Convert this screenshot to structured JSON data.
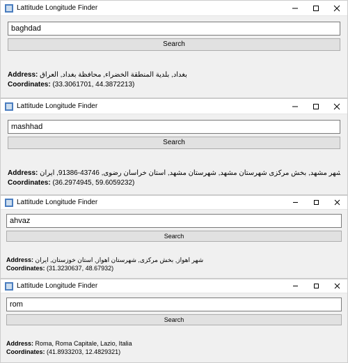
{
  "app_title": "Lattitude Longitude Finder",
  "search_button_label": "Search",
  "labels": {
    "address": "Address:",
    "coordinates": "Coordinates:"
  },
  "windows": [
    {
      "query": "baghdad",
      "address": "بغداد, بلدية المنطقة الخضراء, محافظة بغداد, العراق",
      "coordinates": "(33.3061701, 44.3872213)"
    },
    {
      "query": "mashhad",
      "address": "مشهد, شهر مشهد, بخش مرکزی شهرستان مشهد, شهرستان مشهد, استان خراسان رضوی, 43746-91386, ایران",
      "coordinates": "(36.2974945, 59.6059232)"
    },
    {
      "query": "ahvaz",
      "address": "شهر اهواز, بخش مرکزی, شهرستان اهواز, استان خوزستان, ایران",
      "coordinates": "(31.3230637, 48.67932)"
    },
    {
      "query": "rom",
      "address": "Roma, Roma Capitale, Lazio, Italia",
      "coordinates": "(41.8933203, 12.4829321)"
    }
  ]
}
